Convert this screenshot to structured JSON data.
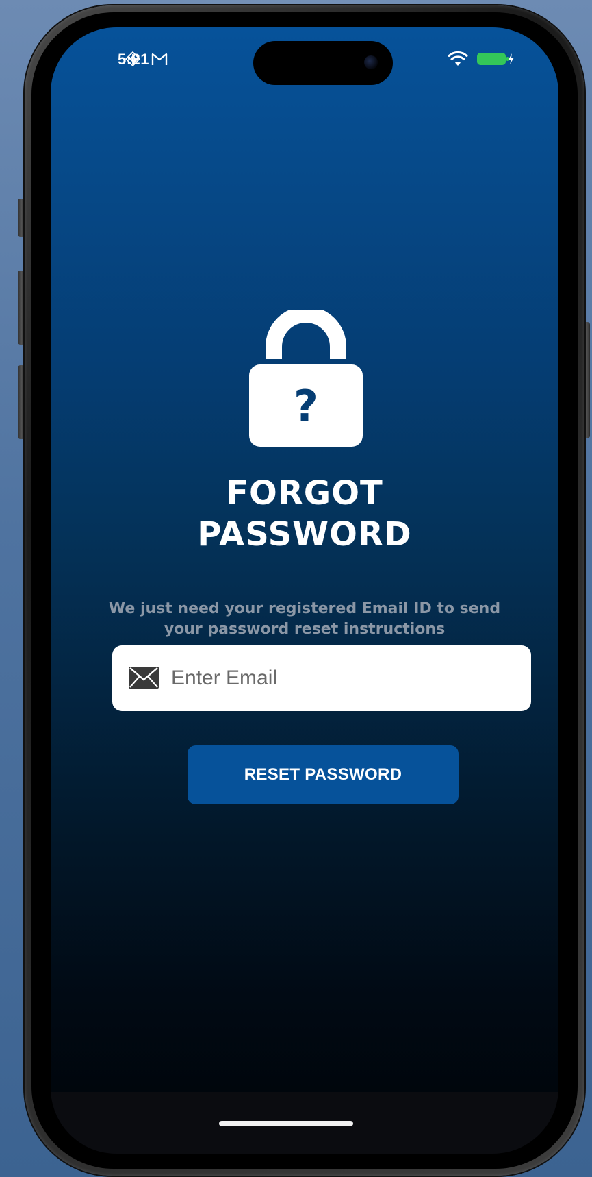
{
  "status_bar": {
    "time": "5:21",
    "left_icons": [
      "translate-app-icon",
      "gmail-icon"
    ],
    "right_icons": [
      "wifi-icon",
      "battery-charging-icon"
    ],
    "battery_color": "#34c759"
  },
  "main": {
    "icon": "padlock-question-icon",
    "title_line1": "FORGOT",
    "title_line2": "PASSWORD",
    "subtitle_line1": "We just need your registered Email ID to send",
    "subtitle_line2": "your password reset instructions",
    "email": {
      "icon": "envelope-icon",
      "placeholder": "Enter Email",
      "value": ""
    },
    "reset_button_label": "RESET PASSWORD"
  },
  "colors": {
    "accent": "#06529a",
    "background_top": "#06529a",
    "background_bottom": "#000307",
    "subtitle": "#8b97a6"
  }
}
